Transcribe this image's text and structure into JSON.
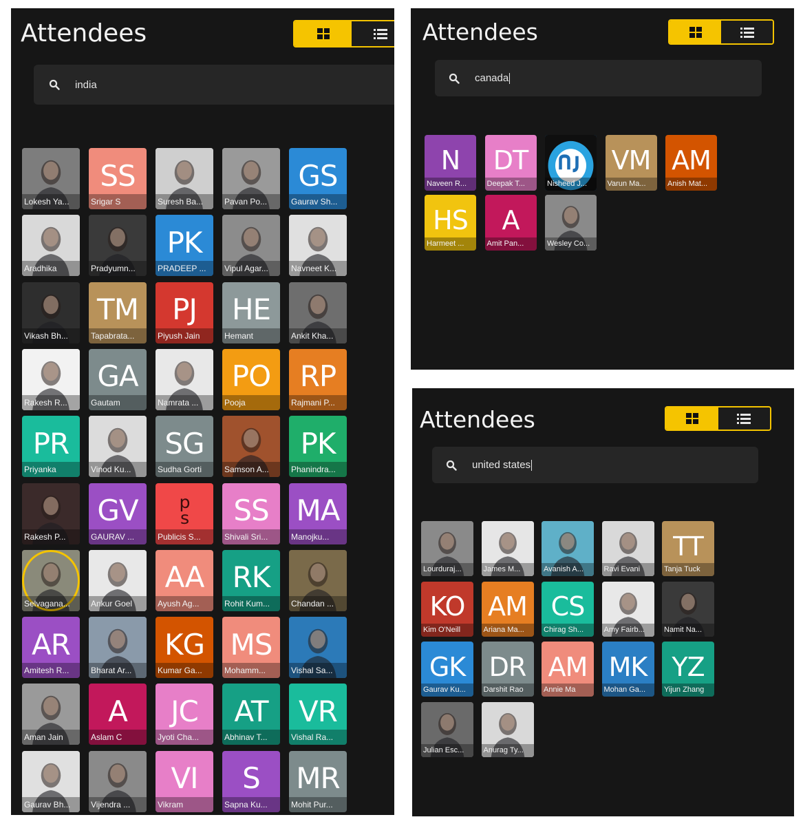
{
  "panels": [
    {
      "id": "india",
      "title": "Attendees",
      "search_value": "india",
      "show_caret": false,
      "attendees": [
        {
          "name": "Lokesh Ya...",
          "initials": "",
          "photo": true,
          "color": "#7d7d7d"
        },
        {
          "name": "Srigar S",
          "initials": "SS",
          "photo": false,
          "color": "#f08c7c"
        },
        {
          "name": "Suresh Ba...",
          "initials": "",
          "photo": true,
          "color": "#cfcfcf"
        },
        {
          "name": "Pavan Po...",
          "initials": "",
          "photo": true,
          "color": "#9a9a9a"
        },
        {
          "name": "Gaurav Sh...",
          "initials": "GS",
          "photo": false,
          "color": "#2b8ad6"
        },
        {
          "name": "Aradhika",
          "initials": "",
          "photo": true,
          "color": "#d9d9d9"
        },
        {
          "name": "Pradyumn...",
          "initials": "",
          "photo": true,
          "color": "#3a3a3a"
        },
        {
          "name": "PRADEEP ...",
          "initials": "PK",
          "photo": false,
          "color": "#2b8ad6"
        },
        {
          "name": "Vipul Agar...",
          "initials": "",
          "photo": true,
          "color": "#8c8c8c"
        },
        {
          "name": "Navneet K...",
          "initials": "",
          "photo": true,
          "color": "#e0e0e0"
        },
        {
          "name": "Vikash Bh...",
          "initials": "",
          "photo": true,
          "color": "#2e2e2e"
        },
        {
          "name": "Tapabrata...",
          "initials": "TM",
          "photo": false,
          "color": "#b8925a"
        },
        {
          "name": "Piyush Jain",
          "initials": "PJ",
          "photo": false,
          "color": "#d4382f"
        },
        {
          "name": "Hemant",
          "initials": "HE",
          "photo": false,
          "color": "#8d999a"
        },
        {
          "name": "Ankit Kha...",
          "initials": "",
          "photo": true,
          "color": "#6e6e6e"
        },
        {
          "name": "Rakesh R...",
          "initials": "",
          "photo": true,
          "color": "#f2f2f2"
        },
        {
          "name": "Gautam",
          "initials": "GA",
          "photo": false,
          "color": "#7d8b8c"
        },
        {
          "name": "Namrata ...",
          "initials": "",
          "photo": true,
          "color": "#e8e8e8"
        },
        {
          "name": "Pooja",
          "initials": "PO",
          "photo": false,
          "color": "#f39c12"
        },
        {
          "name": "Rajmani P...",
          "initials": "RP",
          "photo": false,
          "color": "#e67e22"
        },
        {
          "name": "Priyanka",
          "initials": "PR",
          "photo": false,
          "color": "#1abc9c"
        },
        {
          "name": "Vinod Ku...",
          "initials": "",
          "photo": true,
          "color": "#dcdcdc"
        },
        {
          "name": "Sudha Gorti",
          "initials": "SG",
          "photo": false,
          "color": "#7d8b8c"
        },
        {
          "name": "Samson A...",
          "initials": "",
          "photo": true,
          "color": "#a0522d"
        },
        {
          "name": "Phanindra...",
          "initials": "PK",
          "photo": false,
          "color": "#1fae6a"
        },
        {
          "name": "Rakesh P...",
          "initials": "",
          "photo": true,
          "color": "#3b2a2a"
        },
        {
          "name": "GAURAV ...",
          "initials": "GV",
          "photo": false,
          "color": "#9b4fc4"
        },
        {
          "name": "Publicis S...",
          "initials": "p s",
          "photo": false,
          "color": "#f04848"
        },
        {
          "name": "Shivali Sri...",
          "initials": "SS",
          "photo": false,
          "color": "#e77fc8"
        },
        {
          "name": "Manojku...",
          "initials": "MA",
          "photo": false,
          "color": "#9b4fc4"
        },
        {
          "name": "Selvagana...",
          "initials": "",
          "photo": true,
          "color": "#8a8a7a",
          "ring": true
        },
        {
          "name": "Ankur Goel",
          "initials": "",
          "photo": true,
          "color": "#e8e8e8"
        },
        {
          "name": "Ayush Ag...",
          "initials": "AA",
          "photo": false,
          "color": "#f08c7c"
        },
        {
          "name": "Rohit Kum...",
          "initials": "RK",
          "photo": false,
          "color": "#16a085"
        },
        {
          "name": "Chandan ...",
          "initials": "",
          "photo": true,
          "color": "#7a6a4a"
        },
        {
          "name": "Amitesh R...",
          "initials": "AR",
          "photo": false,
          "color": "#9b4fc4"
        },
        {
          "name": "Bharat Ar...",
          "initials": "",
          "photo": true,
          "color": "#8a9aaa"
        },
        {
          "name": "Kumar Ga...",
          "initials": "KG",
          "photo": false,
          "color": "#d35400"
        },
        {
          "name": "Mohamm...",
          "initials": "MS",
          "photo": false,
          "color": "#f08c7c"
        },
        {
          "name": "Vishal Sa...",
          "initials": "",
          "photo": true,
          "color": "#2c7ab8"
        },
        {
          "name": "Aman Jain",
          "initials": "",
          "photo": true,
          "color": "#9a9a9a"
        },
        {
          "name": "Aslam C",
          "initials": "A",
          "photo": false,
          "color": "#c2185b"
        },
        {
          "name": "Jyoti Cha...",
          "initials": "JC",
          "photo": false,
          "color": "#e77fc8"
        },
        {
          "name": "Abhinav T...",
          "initials": "AT",
          "photo": false,
          "color": "#16a085"
        },
        {
          "name": "Vishal Ra...",
          "initials": "VR",
          "photo": false,
          "color": "#1abc9c"
        },
        {
          "name": "Gaurav Bh...",
          "initials": "",
          "photo": true,
          "color": "#e0e0e0"
        },
        {
          "name": "Vijendra ...",
          "initials": "",
          "photo": true,
          "color": "#8a8a8a"
        },
        {
          "name": "Vikram",
          "initials": "VI",
          "photo": false,
          "color": "#e77fc8"
        },
        {
          "name": "Sapna Ku...",
          "initials": "S",
          "photo": false,
          "color": "#9b4fc4"
        },
        {
          "name": "Mohit Pur...",
          "initials": "MR",
          "photo": false,
          "color": "#7d8b8c"
        }
      ]
    },
    {
      "id": "canada",
      "title": "Attendees",
      "search_value": "canada",
      "show_caret": true,
      "attendees": [
        {
          "name": "Naveen R...",
          "initials": "N",
          "photo": false,
          "color": "#8e44ad"
        },
        {
          "name": "Deepak T...",
          "initials": "DT",
          "photo": false,
          "color": "#e77fc8"
        },
        {
          "name": "Nisheed J...",
          "initials": "",
          "photo": true,
          "color": "#1e6fb5",
          "logo": true
        },
        {
          "name": "Varun Ma...",
          "initials": "VM",
          "photo": false,
          "color": "#b8925a"
        },
        {
          "name": "Anish Mat...",
          "initials": "AM",
          "photo": false,
          "color": "#d35400"
        },
        {
          "name": "Harmeet ...",
          "initials": "HS",
          "photo": false,
          "color": "#f1c40f"
        },
        {
          "name": "Amit Pan...",
          "initials": "A",
          "photo": false,
          "color": "#c2185b"
        },
        {
          "name": "Wesley Co...",
          "initials": "",
          "photo": true,
          "color": "#8a8a8a"
        }
      ]
    },
    {
      "id": "united-states",
      "title": "Attendees",
      "search_value": "united states",
      "show_caret": true,
      "attendees": [
        {
          "name": "Lourduraj...",
          "initials": "",
          "photo": true,
          "color": "#8a8a8a"
        },
        {
          "name": "James M...",
          "initials": "",
          "photo": true,
          "color": "#e6e6e6"
        },
        {
          "name": "Avanish A...",
          "initials": "",
          "photo": true,
          "color": "#5fb0c8"
        },
        {
          "name": "Ravi Evani",
          "initials": "",
          "photo": true,
          "color": "#d9d9d9"
        },
        {
          "name": "Tanja Tuck",
          "initials": "TT",
          "photo": false,
          "color": "#b8925a"
        },
        {
          "name": "Kim O'Neill",
          "initials": "KO",
          "photo": false,
          "color": "#c0392b"
        },
        {
          "name": "Ariana Ma...",
          "initials": "AM",
          "photo": false,
          "color": "#e67e22"
        },
        {
          "name": "Chirag Sh...",
          "initials": "CS",
          "photo": false,
          "color": "#1abc9c"
        },
        {
          "name": "Amy Fairb...",
          "initials": "",
          "photo": true,
          "color": "#e8e8e8"
        },
        {
          "name": "Namit Na...",
          "initials": "",
          "photo": true,
          "color": "#3a3a3a"
        },
        {
          "name": "Gaurav Ku...",
          "initials": "GK",
          "photo": false,
          "color": "#2b8ad6"
        },
        {
          "name": "Darshit Rao",
          "initials": "DR",
          "photo": false,
          "color": "#7d8b8c"
        },
        {
          "name": "Annie Ma",
          "initials": "AM",
          "photo": false,
          "color": "#f08c7c"
        },
        {
          "name": "Mohan Ga...",
          "initials": "MK",
          "photo": false,
          "color": "#2b7fc4"
        },
        {
          "name": "Yijun Zhang",
          "initials": "YZ",
          "photo": false,
          "color": "#16a085"
        },
        {
          "name": "Julian Esc...",
          "initials": "",
          "photo": true,
          "color": "#6a6a6a"
        },
        {
          "name": "Anurag Ty...",
          "initials": "",
          "photo": true,
          "color": "#d9d9d9"
        }
      ]
    }
  ]
}
